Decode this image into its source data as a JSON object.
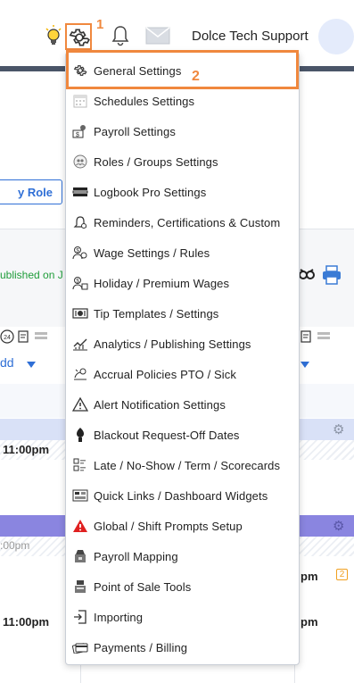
{
  "header": {
    "user_name": "Dolce Tech Support",
    "annotation_1": "1",
    "annotation_2": "2"
  },
  "background": {
    "role_button_label": "y Role",
    "published_text": "ublished on J",
    "add_link": "dd",
    "times": [
      "11:00pm",
      "11:00pm",
      "11:00pm",
      "pm",
      "pm"
    ],
    "faint_time": ":00pm",
    "badge": "2"
  },
  "menu": {
    "items": [
      {
        "label": "General Settings",
        "icon": "gear-icon"
      },
      {
        "label": "Schedules Settings",
        "icon": "calendar-icon"
      },
      {
        "label": "Payroll Settings",
        "icon": "payroll-icon"
      },
      {
        "label": "Roles / Groups Settings",
        "icon": "roles-icon"
      },
      {
        "label": "Logbook Pro Settings",
        "icon": "logbook-icon"
      },
      {
        "label": "Reminders, Certifications & Custom",
        "icon": "reminder-bell-icon"
      },
      {
        "label": "Wage Settings / Rules",
        "icon": "wage-icon"
      },
      {
        "label": "Holiday / Premium Wages",
        "icon": "holiday-wage-icon"
      },
      {
        "label": "Tip Templates / Settings",
        "icon": "tip-icon"
      },
      {
        "label": "Analytics / Publishing Settings",
        "icon": "analytics-icon"
      },
      {
        "label": "Accrual Policies PTO / Sick",
        "icon": "accrual-icon"
      },
      {
        "label": "Alert Notification Settings",
        "icon": "alert-triangle-icon"
      },
      {
        "label": "Blackout Request-Off Dates",
        "icon": "blackout-icon"
      },
      {
        "label": "Late / No-Show / Term / Scorecards",
        "icon": "scorecard-icon"
      },
      {
        "label": "Quick Links / Dashboard Widgets",
        "icon": "quick-links-icon"
      },
      {
        "label": "Global / Shift Prompts Setup",
        "icon": "warning-red-icon"
      },
      {
        "label": "Payroll Mapping",
        "icon": "payroll-mapping-icon"
      },
      {
        "label": "Point of Sale Tools",
        "icon": "pos-icon"
      },
      {
        "label": "Importing",
        "icon": "import-icon"
      },
      {
        "label": "Payments / Billing",
        "icon": "payments-icon"
      }
    ]
  },
  "colors": {
    "annotation": "#f0883e",
    "accent": "#2f6fd6",
    "published": "#1f9d3a",
    "purple_band": "#8a85e0",
    "light_band": "#d9e1f7"
  }
}
